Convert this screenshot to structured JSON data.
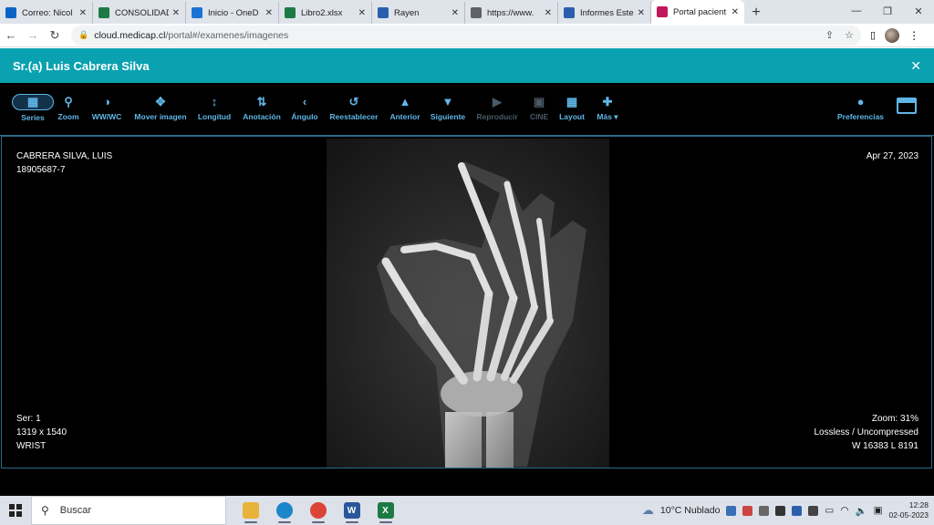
{
  "browser": {
    "tabs": [
      {
        "title": "Correo: Nicol",
        "favicon": "outlook-icon",
        "color": "#0a64c8",
        "active": false
      },
      {
        "title": "CONSOLIDAD",
        "favicon": "excel-icon",
        "color": "#1d7a45",
        "active": false
      },
      {
        "title": "Inicio - OneD",
        "favicon": "onedrive-icon",
        "color": "#1b73d4",
        "active": false
      },
      {
        "title": "Libro2.xlsx",
        "favicon": "excel-icon",
        "color": "#1d7a45",
        "active": false
      },
      {
        "title": "Rayen",
        "favicon": "rayen-icon",
        "color": "#2b5fae",
        "active": false
      },
      {
        "title": "https://www.",
        "favicon": "globe-icon",
        "color": "#5f6368",
        "active": false
      },
      {
        "title": "Informes Este",
        "favicon": "rayen-icon",
        "color": "#2b5fae",
        "active": false
      },
      {
        "title": "Portal pacient",
        "favicon": "heart-icon",
        "color": "#c2185b",
        "active": true
      }
    ],
    "url_host": "cloud.medicap.cl",
    "url_path": "/portal#/examenes/imagenes"
  },
  "patient_bar": {
    "title": "Sr.(a) Luis Cabrera Silva"
  },
  "toolbar": {
    "items": [
      {
        "label": "Series",
        "icon": "series-icon",
        "glyph": "▦",
        "enabled": true
      },
      {
        "label": "Zoom",
        "icon": "search-icon",
        "glyph": "⚲",
        "enabled": true
      },
      {
        "label": "WW/WC",
        "icon": "contrast-icon",
        "glyph": "◑",
        "enabled": true
      },
      {
        "label": "Mover imagen",
        "icon": "move-icon",
        "glyph": "✥",
        "enabled": true
      },
      {
        "label": "Longitud",
        "icon": "ruler-icon",
        "glyph": "↕",
        "enabled": true
      },
      {
        "label": "Anotación",
        "icon": "annotation-icon",
        "glyph": "⇅",
        "enabled": true
      },
      {
        "label": "Ángulo",
        "icon": "angle-icon",
        "glyph": "‹",
        "enabled": true
      },
      {
        "label": "Reestablecer",
        "icon": "reset-icon",
        "glyph": "↺",
        "enabled": true
      },
      {
        "label": "Anterior",
        "icon": "previous-icon",
        "glyph": "▲",
        "enabled": true
      },
      {
        "label": "Siguiente",
        "icon": "next-icon",
        "glyph": "▼",
        "enabled": true
      },
      {
        "label": "Reproducir",
        "icon": "play-icon",
        "glyph": "▶",
        "enabled": false
      },
      {
        "label": "CINE",
        "icon": "video-icon",
        "glyph": "▣",
        "enabled": false
      },
      {
        "label": "Layout",
        "icon": "layout-icon",
        "glyph": "▦",
        "enabled": true
      },
      {
        "label": "Más ▾",
        "icon": "plus-icon",
        "glyph": "✚",
        "enabled": true
      }
    ],
    "preferences": {
      "label": "Preferencias",
      "icon": "user-icon",
      "glyph": "👤"
    }
  },
  "viewer": {
    "top_left": [
      "CABRERA SILVA, LUIS",
      "18905687-7"
    ],
    "top_right": [
      "Apr 27, 2023"
    ],
    "bottom_left": [
      "Ser: 1",
      "1319 x 1540",
      "WRIST"
    ],
    "bottom_right": [
      "Zoom: 31%",
      "Lossless / Uncompressed",
      "W 16383 L 8191"
    ]
  },
  "taskbar": {
    "search_placeholder": "Buscar",
    "apps": [
      {
        "name": "file-explorer-icon",
        "color": "#e8b339"
      },
      {
        "name": "edge-icon",
        "color": "#1b86c9"
      },
      {
        "name": "chrome-icon",
        "color": "#db4437"
      },
      {
        "name": "word-icon",
        "color": "#2b579a",
        "glyph": "W"
      },
      {
        "name": "excel-icon",
        "color": "#1d7a45",
        "glyph": "X"
      }
    ],
    "weather": "10°C  Nublado",
    "time": "12:28",
    "date": "02-05-2023"
  }
}
